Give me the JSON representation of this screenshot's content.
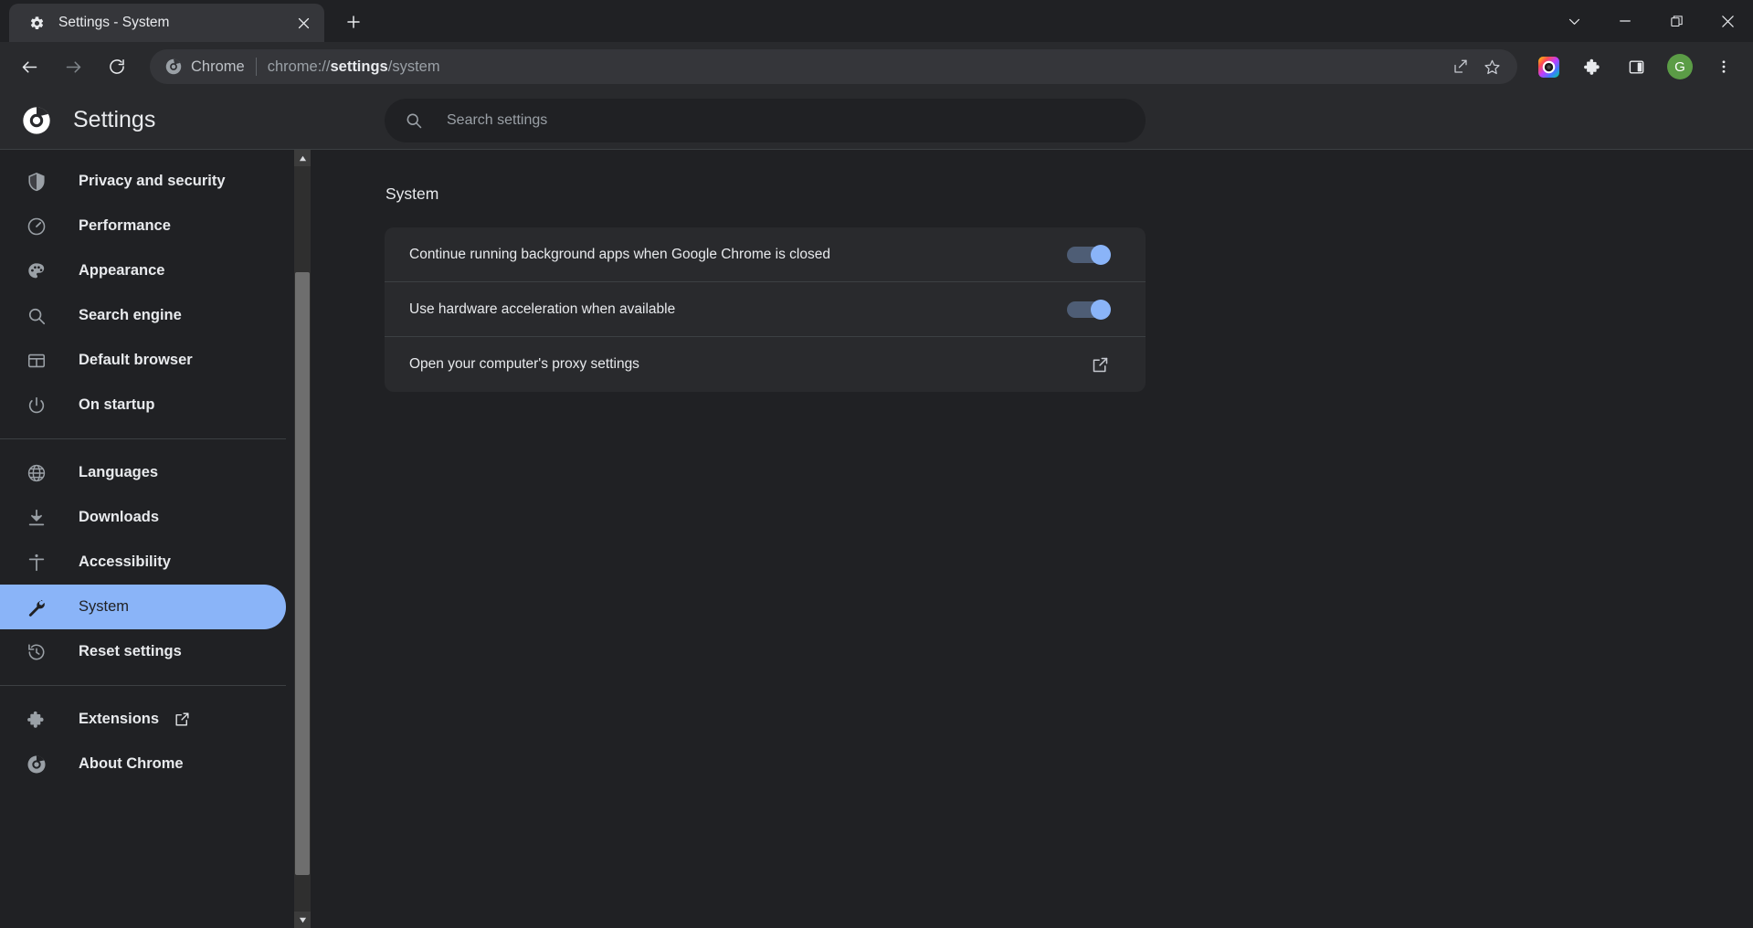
{
  "window": {
    "controls": [
      {
        "name": "tab-search",
        "icon": "chevron-down-icon"
      },
      {
        "name": "minimize",
        "icon": "minimize-icon"
      },
      {
        "name": "restore",
        "icon": "restore-icon"
      },
      {
        "name": "close",
        "icon": "close-icon"
      }
    ]
  },
  "tabstrip": {
    "tabs": [
      {
        "title": "Settings - System",
        "favicon": "gear-icon",
        "close_label": "×"
      }
    ],
    "new_tab_label": "+"
  },
  "toolbar": {
    "back_label": "Back",
    "forward_label": "Forward",
    "reload_label": "Reload",
    "omnibox": {
      "chip_label": "Chrome",
      "url_prefix": "chrome://",
      "url_bold": "settings",
      "url_suffix": "/system",
      "full_url": "chrome://settings/system"
    },
    "right_icons": [
      {
        "name": "share-icon",
        "label": "Share this page"
      },
      {
        "name": "bookmark-star-icon",
        "label": "Bookmark this tab"
      },
      {
        "name": "colorful-circle-icon",
        "label": "Extension"
      },
      {
        "name": "puzzle-icon",
        "label": "Extensions"
      },
      {
        "name": "side-panel-icon",
        "label": "Side panel"
      },
      {
        "name": "profile-avatar",
        "label": "G"
      },
      {
        "name": "kebab-menu-icon",
        "label": "Customize and control Google Chrome"
      }
    ],
    "avatar_initial": "G"
  },
  "settings_header": {
    "title": "Settings",
    "logo": "chrome-logo-icon"
  },
  "search": {
    "placeholder": "Search settings",
    "value": "",
    "icon": "search-icon"
  },
  "sidebar": {
    "groups": [
      {
        "items": [
          {
            "label": "Privacy and security",
            "icon": "shield-icon",
            "active": false
          },
          {
            "label": "Performance",
            "icon": "speedometer-icon",
            "active": false
          },
          {
            "label": "Appearance",
            "icon": "palette-icon",
            "active": false
          },
          {
            "label": "Search engine",
            "icon": "search-icon",
            "active": false
          },
          {
            "label": "Default browser",
            "icon": "browser-window-icon",
            "active": false
          },
          {
            "label": "On startup",
            "icon": "power-icon",
            "active": false
          }
        ]
      },
      {
        "items": [
          {
            "label": "Languages",
            "icon": "globe-icon",
            "active": false
          },
          {
            "label": "Downloads",
            "icon": "download-icon",
            "active": false
          },
          {
            "label": "Accessibility",
            "icon": "accessibility-icon",
            "active": false
          },
          {
            "label": "System",
            "icon": "wrench-icon",
            "active": true
          },
          {
            "label": "Reset settings",
            "icon": "history-restore-icon",
            "active": false
          }
        ]
      },
      {
        "items": [
          {
            "label": "Extensions",
            "icon": "puzzle-icon",
            "active": false,
            "external": true
          },
          {
            "label": "About Chrome",
            "icon": "chrome-logo-icon",
            "active": false
          }
        ]
      }
    ]
  },
  "main": {
    "section_title": "System",
    "rows": [
      {
        "label": "Continue running background apps when Google Chrome is closed",
        "control": "toggle",
        "state": "on"
      },
      {
        "label": "Use hardware acceleration when available",
        "control": "toggle",
        "state": "on"
      },
      {
        "label": "Open your computer's proxy settings",
        "control": "external-link",
        "state": ""
      }
    ]
  },
  "colors": {
    "bg": "#202124",
    "surface": "#292a2d",
    "accent": "#8ab4f8",
    "text_primary": "#e8eaed",
    "text_secondary": "#9aa0a6",
    "divider": "#3c4043",
    "toggle_track": "#4e5d75",
    "avatar_bg": "#5b9c46"
  }
}
